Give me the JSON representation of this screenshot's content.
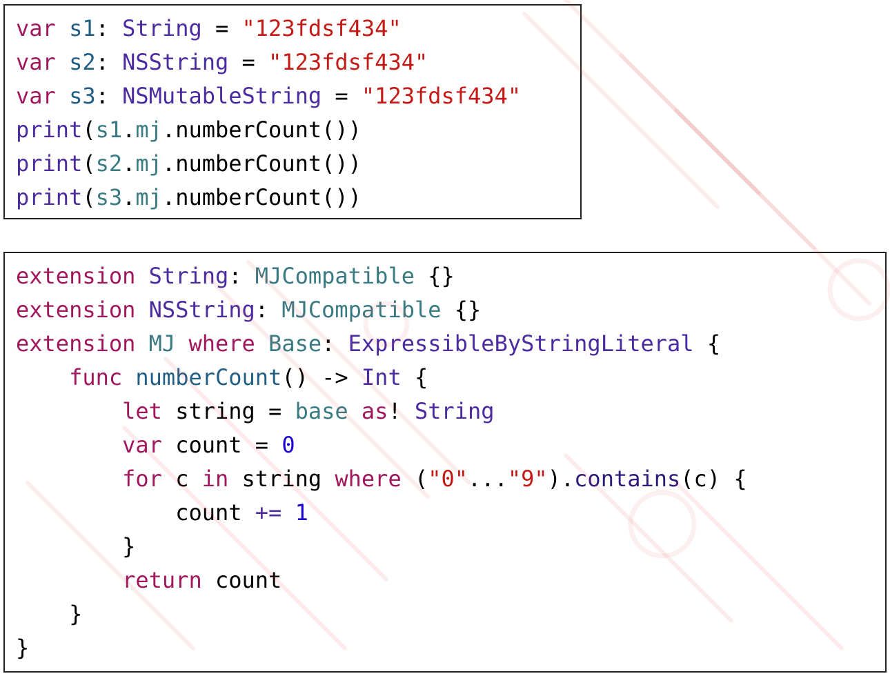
{
  "colors": {
    "keyword": "#a0175e",
    "identifier": "#215e85",
    "type": "#4c2aa0",
    "project_symbol": "#3a7a82",
    "string": "#c41a16",
    "number": "#1c00cf",
    "method": "#2f1b7a",
    "plain": "#000000",
    "border": "#1f1f1f"
  },
  "snippet1": {
    "lines": [
      [
        {
          "t": "var",
          "c": "kw"
        },
        {
          "t": " ",
          "c": "txt"
        },
        {
          "t": "s1",
          "c": "id"
        },
        {
          "t": ": ",
          "c": "txt"
        },
        {
          "t": "String",
          "c": "cls"
        },
        {
          "t": " = ",
          "c": "txt"
        },
        {
          "t": "\"123fdsf434\"",
          "c": "str"
        }
      ],
      [
        {
          "t": "var",
          "c": "kw"
        },
        {
          "t": " ",
          "c": "txt"
        },
        {
          "t": "s2",
          "c": "id"
        },
        {
          "t": ": ",
          "c": "txt"
        },
        {
          "t": "NSString",
          "c": "cls"
        },
        {
          "t": " = ",
          "c": "txt"
        },
        {
          "t": "\"123fdsf434\"",
          "c": "str"
        }
      ],
      [
        {
          "t": "var",
          "c": "kw"
        },
        {
          "t": " ",
          "c": "txt"
        },
        {
          "t": "s3",
          "c": "id"
        },
        {
          "t": ": ",
          "c": "txt"
        },
        {
          "t": "NSMutableString",
          "c": "cls"
        },
        {
          "t": " = ",
          "c": "txt"
        },
        {
          "t": "\"123fdsf434\"",
          "c": "str"
        }
      ],
      [
        {
          "t": "print",
          "c": "cls"
        },
        {
          "t": "(",
          "c": "txt"
        },
        {
          "t": "s1",
          "c": "prj"
        },
        {
          "t": ".",
          "c": "txt"
        },
        {
          "t": "mj",
          "c": "prj"
        },
        {
          "t": ".",
          "c": "txt"
        },
        {
          "t": "numberCount",
          "c": "txt"
        },
        {
          "t": "())",
          "c": "txt"
        }
      ],
      [
        {
          "t": "print",
          "c": "cls"
        },
        {
          "t": "(",
          "c": "txt"
        },
        {
          "t": "s2",
          "c": "prj"
        },
        {
          "t": ".",
          "c": "txt"
        },
        {
          "t": "mj",
          "c": "prj"
        },
        {
          "t": ".",
          "c": "txt"
        },
        {
          "t": "numberCount",
          "c": "txt"
        },
        {
          "t": "())",
          "c": "txt"
        }
      ],
      [
        {
          "t": "print",
          "c": "cls"
        },
        {
          "t": "(",
          "c": "txt"
        },
        {
          "t": "s3",
          "c": "prj"
        },
        {
          "t": ".",
          "c": "txt"
        },
        {
          "t": "mj",
          "c": "prj"
        },
        {
          "t": ".",
          "c": "txt"
        },
        {
          "t": "numberCount",
          "c": "txt"
        },
        {
          "t": "())",
          "c": "txt"
        }
      ]
    ]
  },
  "snippet2": {
    "lines": [
      [
        {
          "t": "extension",
          "c": "kw"
        },
        {
          "t": " ",
          "c": "txt"
        },
        {
          "t": "String",
          "c": "cls"
        },
        {
          "t": ": ",
          "c": "txt"
        },
        {
          "t": "MJCompatible",
          "c": "prj"
        },
        {
          "t": " {}",
          "c": "txt"
        }
      ],
      [
        {
          "t": "extension",
          "c": "kw"
        },
        {
          "t": " ",
          "c": "txt"
        },
        {
          "t": "NSString",
          "c": "cls"
        },
        {
          "t": ": ",
          "c": "txt"
        },
        {
          "t": "MJCompatible",
          "c": "prj"
        },
        {
          "t": " {}",
          "c": "txt"
        }
      ],
      [
        {
          "t": "extension",
          "c": "kw"
        },
        {
          "t": " ",
          "c": "txt"
        },
        {
          "t": "MJ",
          "c": "prj"
        },
        {
          "t": " ",
          "c": "txt"
        },
        {
          "t": "where",
          "c": "kw"
        },
        {
          "t": " ",
          "c": "txt"
        },
        {
          "t": "Base",
          "c": "prj"
        },
        {
          "t": ": ",
          "c": "txt"
        },
        {
          "t": "ExpressibleByStringLiteral",
          "c": "cls"
        },
        {
          "t": " {",
          "c": "txt"
        }
      ],
      [
        {
          "t": "    ",
          "c": "txt"
        },
        {
          "t": "func",
          "c": "kw"
        },
        {
          "t": " ",
          "c": "txt"
        },
        {
          "t": "numberCount",
          "c": "id"
        },
        {
          "t": "() -> ",
          "c": "txt"
        },
        {
          "t": "Int",
          "c": "cls"
        },
        {
          "t": " {",
          "c": "txt"
        }
      ],
      [
        {
          "t": "        ",
          "c": "txt"
        },
        {
          "t": "let",
          "c": "kw"
        },
        {
          "t": " string = ",
          "c": "txt"
        },
        {
          "t": "base",
          "c": "prj"
        },
        {
          "t": " ",
          "c": "txt"
        },
        {
          "t": "as",
          "c": "kw"
        },
        {
          "t": "! ",
          "c": "txt"
        },
        {
          "t": "String",
          "c": "cls"
        }
      ],
      [
        {
          "t": "        ",
          "c": "txt"
        },
        {
          "t": "var",
          "c": "kw"
        },
        {
          "t": " count = ",
          "c": "txt"
        },
        {
          "t": "0",
          "c": "num"
        }
      ],
      [
        {
          "t": "        ",
          "c": "txt"
        },
        {
          "t": "for",
          "c": "kw"
        },
        {
          "t": " c ",
          "c": "txt"
        },
        {
          "t": "in",
          "c": "kw"
        },
        {
          "t": " string ",
          "c": "txt"
        },
        {
          "t": "where",
          "c": "kw"
        },
        {
          "t": " (",
          "c": "txt"
        },
        {
          "t": "\"0\"",
          "c": "str"
        },
        {
          "t": "...",
          "c": "txt"
        },
        {
          "t": "\"9\"",
          "c": "str"
        },
        {
          "t": ").",
          "c": "txt"
        },
        {
          "t": "contains",
          "c": "mth"
        },
        {
          "t": "(c) {",
          "c": "txt"
        }
      ],
      [
        {
          "t": "            count ",
          "c": "txt"
        },
        {
          "t": "+=",
          "c": "cls"
        },
        {
          "t": " ",
          "c": "txt"
        },
        {
          "t": "1",
          "c": "num"
        }
      ],
      [
        {
          "t": "        }",
          "c": "txt"
        }
      ],
      [
        {
          "t": "        ",
          "c": "txt"
        },
        {
          "t": "return",
          "c": "kw"
        },
        {
          "t": " count",
          "c": "txt"
        }
      ],
      [
        {
          "t": "    }",
          "c": "txt"
        }
      ],
      [
        {
          "t": "}",
          "c": "txt"
        }
      ]
    ]
  }
}
